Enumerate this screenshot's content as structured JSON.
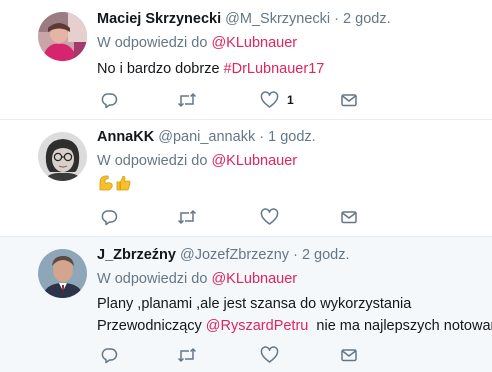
{
  "tweets": [
    {
      "name": "Maciej Skrzynecki",
      "handle": "@M_Skrzynecki",
      "time": "2 godz.",
      "reply_prefix": "W odpowiedzi do",
      "reply_to": "@KLubnauer",
      "text_plain": "No i bardzo dobrze ",
      "hashtag": "#DrLubnauer17",
      "like_count": "1"
    },
    {
      "name": "AnnaKK",
      "handle": "@pani_annakk",
      "time": "1 godz.",
      "reply_prefix": "W odpowiedzi do",
      "reply_to": "@KLubnauer",
      "emoji": [
        "flexed-biceps",
        "thumbs-up"
      ]
    },
    {
      "name": "J_Zbrzeźny",
      "handle": "@JozefZbrzezny",
      "time": "2 godz.",
      "reply_prefix": "W odpowiedzi do",
      "reply_to": "@KLubnauer",
      "line1": "Plany ,planami ,ale jest szansa do wykorzystania",
      "line2_before": "Przewodniczący ",
      "line2_mention": "@RyszardPetru",
      "line2_after": "  nie ma najlepszych notowań"
    }
  ],
  "separator": "·",
  "icons": {
    "reply": "reply-icon",
    "retweet": "retweet-icon",
    "like": "heart-icon",
    "message": "direct-message-icon"
  },
  "colors": {
    "mention": "#e0245e",
    "secondary_text": "#657786",
    "icon": "#657786",
    "highlight_bg": "#f5f8fa"
  }
}
